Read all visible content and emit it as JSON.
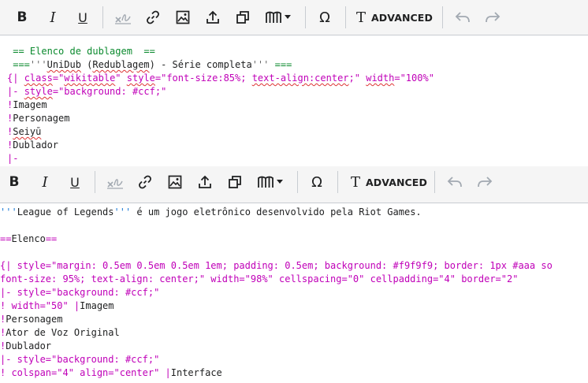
{
  "toolbar": {
    "bold_label": "B",
    "italic_label": "I",
    "underline_label": "U",
    "advanced_icon_label": "T",
    "advanced_label": "ADVANCED",
    "special_char_label": "Ω"
  },
  "editor_top": {
    "lines": [
      {
        "a": " == Elenco de dublagem  =="
      },
      {
        "a": " ===",
        "b": "'''",
        "c": "UniDub",
        "d": " (",
        "e": "Redublagem",
        "f": ") - Série completa",
        "g": "'''",
        "h": " ==="
      },
      {
        "a": "{| ",
        "b": "class",
        "c": "=\"",
        "d": "wikitable",
        "e": "\" ",
        "f": "style",
        "g": "=\"font-size:85%; ",
        "h": "text-align:center",
        "i": ";\" ",
        "j": "width",
        "k": "=\"100%\""
      },
      {
        "a": "|- ",
        "b": "style",
        "c": "=\"background: #ccf;\""
      },
      {
        "a": "!",
        "b": "Imagem"
      },
      {
        "a": "!",
        "b": "Personagem"
      },
      {
        "a": "!",
        "b": "Seiyū"
      },
      {
        "a": "!",
        "b": "Dublador"
      },
      {
        "a": "|-"
      }
    ]
  },
  "editor_bottom": {
    "lines": [
      {
        "a": "'''",
        "b": "League of Legends",
        "c": "'''",
        "d": " é um jogo eletrônico desenvolvido pela Riot Games."
      },
      {
        "a": ""
      },
      {
        "a": "==",
        "b": "Elenco",
        "c": "=="
      },
      {
        "a": ""
      },
      {
        "a": "{| style=\"margin: 0.5em 0.5em 0.5em 1em; padding: 0.5em; background: #f9f9f9; border: 1px #aaa so"
      },
      {
        "a": "font-size: 95%; text-align: center;\" width=\"98%\" cellspacing=\"0\" cellpadding=\"4\" border=\"2\""
      },
      {
        "a": "|- style=\"background: #ccf;\""
      },
      {
        "a": "! width=\"50\" |",
        "b": "Imagem"
      },
      {
        "a": "!",
        "b": "Personagem"
      },
      {
        "a": "!",
        "b": "Ator de Voz Original"
      },
      {
        "a": "!",
        "b": "Dublador"
      },
      {
        "a": "|- style=\"background: #ccf;\""
      },
      {
        "a": "! colspan=\"4\" align=\"center\" |",
        "b": "Interface"
      }
    ]
  }
}
